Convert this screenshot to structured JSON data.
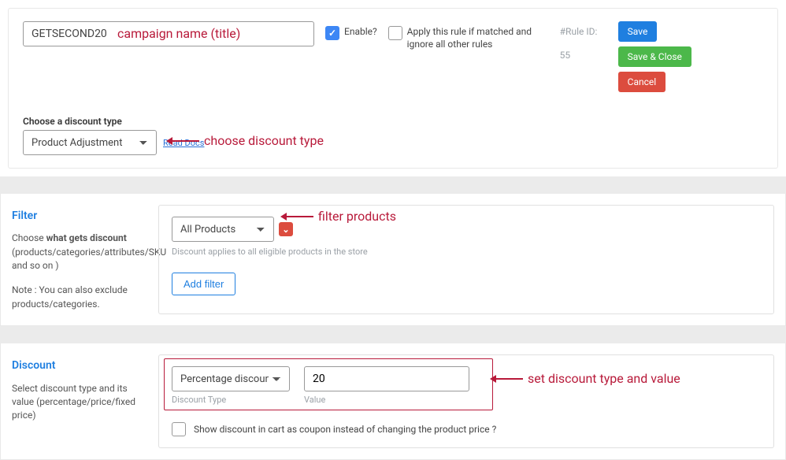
{
  "header": {
    "campaign_name": "GETSECOND20",
    "enable_label": "Enable?",
    "enable_checked": true,
    "apply_rule_label": "Apply this rule if matched and ignore all other rules",
    "apply_rule_checked": false,
    "rule_id_label": "#Rule ID:",
    "rule_id": "55",
    "save_label": "Save",
    "save_close_label": "Save & Close",
    "cancel_label": "Cancel"
  },
  "discount_type": {
    "label": "Choose a discount type",
    "selected": "Product Adjustment",
    "read_docs": "Read Docs"
  },
  "filter": {
    "heading": "Filter",
    "desc_a": "Choose ",
    "desc_bold": "what gets discount",
    "desc_b": " (products/categories/attributes/SKU and so on )",
    "note": "Note : You can also exclude products/categories.",
    "selected": "All Products",
    "hint": "Discount applies to all eligible products in the store",
    "add_filter": "Add filter"
  },
  "discount": {
    "heading": "Discount",
    "desc": "Select discount type and its value (percentage/price/fixed price)",
    "type_selected": "Percentage discount",
    "type_caption": "Discount Type",
    "value": "20",
    "value_caption": "Value",
    "show_cart_label": "Show discount in cart as coupon instead of changing the product price ?"
  },
  "annotations": {
    "campaign": "campaign name (title)",
    "choose_type": "choose discount type",
    "filter_products": "filter products",
    "set_discount": "set discount type and value"
  }
}
